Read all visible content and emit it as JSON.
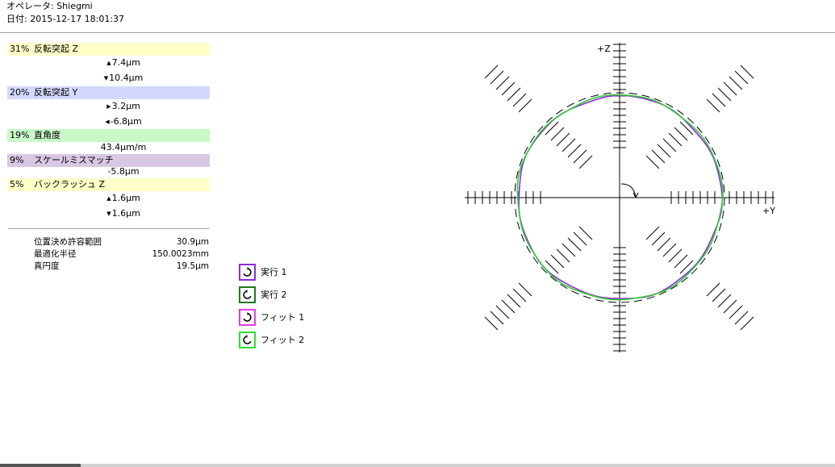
{
  "header": {
    "operator": "オペレータ: Shiegmi",
    "date": "日付: 2015-12-17 18:01:37"
  },
  "errors": [
    {
      "percent": "31%",
      "name": "反転突起 Z",
      "color": "#ffffc8",
      "values": [
        {
          "arrow": "▲",
          "text": "7.4μm"
        },
        {
          "arrow": "▼",
          "text": "10.4μm"
        }
      ]
    },
    {
      "percent": "20%",
      "name": "反転突起 Y",
      "color": "#d4d8fc",
      "values": [
        {
          "arrow": "▶",
          "text": "3.2μm"
        },
        {
          "arrow": "◀",
          "text": "-6.8μm"
        }
      ]
    },
    {
      "percent": "19%",
      "name": "直角度",
      "color": "#c8f8c8",
      "values": [
        {
          "arrow": "",
          "text": "43.4μm/m"
        }
      ]
    },
    {
      "percent": "9%",
      "name": "スケールミスマッチ",
      "color": "#d8c8e4",
      "values": [
        {
          "arrow": "",
          "text": "-5.8μm"
        }
      ]
    },
    {
      "percent": "5%",
      "name": "バックラッシュ Z",
      "color": "#ffffc8",
      "values": [
        {
          "arrow": "▲",
          "text": "1.6μm"
        },
        {
          "arrow": "▼",
          "text": "1.6μm"
        }
      ]
    }
  ],
  "summary": [
    {
      "label": "位置決め許容範囲",
      "value": "30.9μm"
    },
    {
      "label": "最適化半径",
      "value": "150.0023mm"
    },
    {
      "label": "真円度",
      "value": "19.5μm"
    }
  ],
  "legend": [
    {
      "label": "実行 1",
      "color": "#8a2be2",
      "icon": "rotate-clockwise-icon"
    },
    {
      "label": "実行 2",
      "color": "#1e7a1e",
      "icon": "rotate-counterclockwise-icon"
    },
    {
      "label": "フィット 1",
      "color": "#e040e0",
      "icon": "rotate-clockwise-icon"
    },
    {
      "label": "フィット 2",
      "color": "#33dd33",
      "icon": "rotate-counterclockwise-icon"
    }
  ],
  "plot": {
    "axis_z_label": "+Z",
    "axis_y_label": "+Y",
    "trace_colors": {
      "run1": "#8a2be2",
      "run2": "#33cc33"
    }
  }
}
